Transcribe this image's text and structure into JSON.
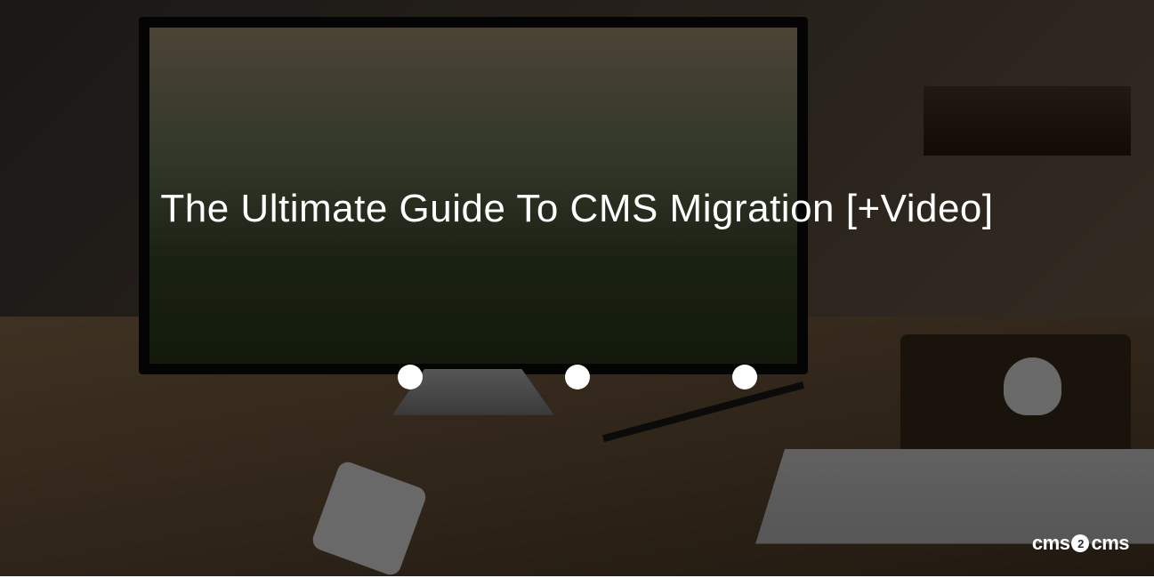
{
  "hero": {
    "title": "The Ultimate Guide To CMS Migration [+Video]"
  },
  "logo": {
    "prefix": "cms",
    "badge": "2",
    "suffix": "cms"
  }
}
